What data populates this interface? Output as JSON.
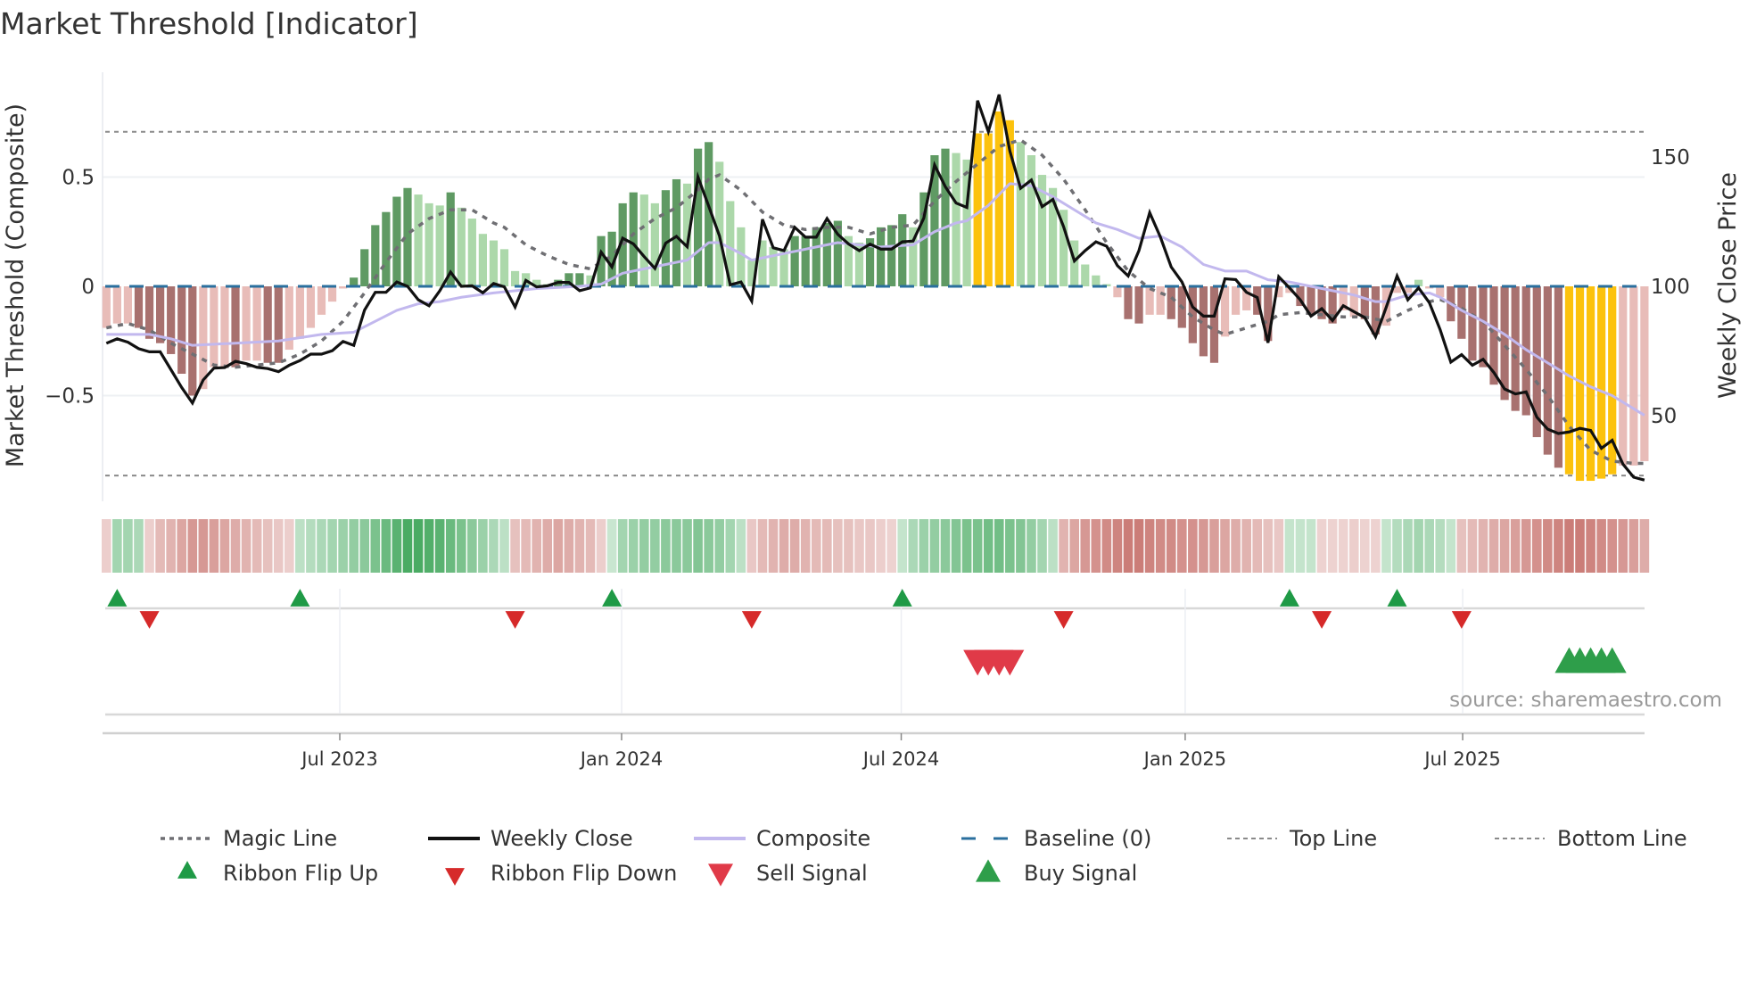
{
  "title": "Market Threshold [Indicator]",
  "source": "source: sharemaestro.com",
  "colors": {
    "dark_green": "#5f9a63",
    "light_green": "#acd8aa",
    "dark_red": "#a8716f",
    "light_red": "#e8bcb8",
    "gold": "#fcc20d",
    "close": "#111111",
    "composite": "#c2b8ee",
    "magic": "#6f6f73",
    "baseline": "#2a6f9e",
    "threshold": "#8a8a8a",
    "flip_up": "#1f9a46",
    "flip_down": "#d62a2a",
    "sell": "#e03a48",
    "buy": "#2e9e4a",
    "ribbon_green": "#3fa65a",
    "ribbon_red": "#c0605a"
  },
  "chart_data": {
    "type": "bar",
    "title": "Market Threshold [Indicator]",
    "xlabel": "",
    "ylabel": "Market Threshold (Composite)",
    "y2label": "Weekly Close Price",
    "ylim": [
      -0.98,
      0.98
    ],
    "y2lim": [
      17,
      183
    ],
    "yticks": [
      {
        "v": 0.5,
        "label": "0.5"
      },
      {
        "v": 0,
        "label": "0"
      },
      {
        "v": -0.5,
        "label": "−0.5"
      }
    ],
    "y2ticks": [
      {
        "v": 150,
        "label": "150"
      },
      {
        "v": 100,
        "label": "100"
      },
      {
        "v": 50,
        "label": "50"
      }
    ],
    "xticks": [
      {
        "week": 21.7,
        "label": "Jul 2023"
      },
      {
        "week": 47.9,
        "label": "Jan 2024"
      },
      {
        "week": 73.9,
        "label": "Jul 2024"
      },
      {
        "week": 100.3,
        "label": "Jan 2025"
      },
      {
        "week": 126.1,
        "label": "Jul 2025"
      }
    ],
    "weeks": 144,
    "top_line": 0.707,
    "bottom_line": -0.866,
    "baseline": 0,
    "composite_bars": [
      -0.19,
      -0.17,
      -0.17,
      -0.19,
      -0.24,
      -0.26,
      -0.31,
      -0.4,
      -0.5,
      -0.47,
      -0.37,
      -0.37,
      -0.37,
      -0.34,
      -0.34,
      -0.35,
      -0.35,
      -0.29,
      -0.24,
      -0.19,
      -0.13,
      -0.07,
      -0.01,
      0.04,
      0.17,
      0.28,
      0.34,
      0.41,
      0.45,
      0.42,
      0.38,
      0.37,
      0.43,
      0.36,
      0.31,
      0.24,
      0.21,
      0.17,
      0.07,
      0.06,
      0.03,
      0.01,
      0.03,
      0.06,
      0.06,
      0.05,
      0.23,
      0.25,
      0.38,
      0.43,
      0.42,
      0.38,
      0.44,
      0.49,
      0.47,
      0.63,
      0.66,
      0.57,
      0.39,
      0.27,
      0.12,
      0.21,
      0.18,
      0.17,
      0.23,
      0.23,
      0.27,
      0.29,
      0.3,
      0.23,
      0.2,
      0.22,
      0.27,
      0.28,
      0.33,
      0.27,
      0.43,
      0.6,
      0.63,
      0.61,
      0.58,
      0.7,
      0.7,
      0.8,
      0.76,
      0.66,
      0.6,
      0.51,
      0.45,
      0.35,
      0.21,
      0.1,
      0.05,
      0.01,
      -0.05,
      -0.15,
      -0.17,
      -0.13,
      -0.13,
      -0.15,
      -0.19,
      -0.26,
      -0.32,
      -0.35,
      -0.23,
      -0.13,
      -0.11,
      -0.13,
      -0.25,
      -0.05,
      -0.03,
      -0.09,
      -0.13,
      -0.15,
      -0.17,
      -0.11,
      -0.14,
      -0.15,
      -0.22,
      -0.18,
      -0.03,
      -0.03,
      0.03,
      -0.01,
      -0.05,
      -0.16,
      -0.24,
      -0.34,
      -0.37,
      -0.45,
      -0.52,
      -0.57,
      -0.59,
      -0.69,
      -0.77,
      -0.83,
      -0.86,
      -0.89,
      -0.89,
      -0.88,
      -0.86,
      -0.82,
      -0.82,
      -0.8
    ],
    "bar_states": [
      "LR",
      "LR",
      "LR",
      "DR",
      "DR",
      "DR",
      "DR",
      "DR",
      "DR",
      "LR",
      "LR",
      "LR",
      "DR",
      "LR",
      "LR",
      "DR",
      "DR",
      "LR",
      "LR",
      "LR",
      "LR",
      "LR",
      "LR",
      "DG",
      "DG",
      "DG",
      "DG",
      "DG",
      "DG",
      "LG",
      "LG",
      "LG",
      "DG",
      "LG",
      "LG",
      "LG",
      "LG",
      "LG",
      "LG",
      "LG",
      "LG",
      "LG",
      "DG",
      "DG",
      "DG",
      "LG",
      "DG",
      "DG",
      "DG",
      "DG",
      "LG",
      "LG",
      "DG",
      "DG",
      "LG",
      "DG",
      "DG",
      "LG",
      "LG",
      "LG",
      "LG",
      "LG",
      "LG",
      "LG",
      "DG",
      "DG",
      "DG",
      "DG",
      "DG",
      "LG",
      "LG",
      "DG",
      "DG",
      "DG",
      "DG",
      "LG",
      "DG",
      "DG",
      "DG",
      "LG",
      "LG",
      "GOLD",
      "GOLD",
      "GOLD",
      "GOLD",
      "LG",
      "LG",
      "LG",
      "LG",
      "LG",
      "LG",
      "LG",
      "LG",
      "LG",
      "LR",
      "DR",
      "DR",
      "LR",
      "LR",
      "DR",
      "DR",
      "DR",
      "DR",
      "DR",
      "LR",
      "LR",
      "LR",
      "DR",
      "DR",
      "LR",
      "LR",
      "DR",
      "DR",
      "DR",
      "DR",
      "LR",
      "LR",
      "DR",
      "DR",
      "LR",
      "LR",
      "LR",
      "LG",
      "LR",
      "LR",
      "DR",
      "DR",
      "DR",
      "DR",
      "DR",
      "DR",
      "DR",
      "DR",
      "DR",
      "DR",
      "DR",
      "GOLD",
      "GOLD",
      "GOLD",
      "GOLD",
      "GOLD",
      "LR",
      "LR",
      "LR"
    ],
    "weekly_close": [
      78,
      79.7,
      78.4,
      75.9,
      74.7,
      74.7,
      67.8,
      60.9,
      54.9,
      63.8,
      68.4,
      68.6,
      71,
      70.1,
      68.7,
      68.2,
      67,
      69.5,
      71.3,
      73.8,
      73.8,
      75.1,
      78.7,
      77.2,
      90.8,
      97.7,
      97.7,
      101.7,
      100,
      94.8,
      92.5,
      98.3,
      105.5,
      100,
      100.2,
      97.5,
      101.1,
      99.8,
      92,
      102.3,
      99.8,
      100.2,
      101.5,
      101.5,
      98.3,
      99.4,
      113.2,
      107.5,
      118.6,
      116.4,
      111.5,
      106.9,
      116.7,
      119.3,
      115.3,
      142.3,
      131,
      119.5,
      100.6,
      101.7,
      94.3,
      125.9,
      114.9,
      113.8,
      122.8,
      119,
      119,
      126.2,
      120.1,
      116.4,
      113.8,
      116.3,
      114.4,
      114.4,
      117.2,
      117.5,
      126.4,
      146.9,
      138.5,
      132.2,
      130.5,
      171.8,
      159.8,
      174.1,
      152.3,
      137.9,
      141.1,
      130.8,
      133.6,
      123,
      109.8,
      113.8,
      117.2,
      115.5,
      108,
      104,
      113.8,
      128.5,
      119,
      107.5,
      101.7,
      92,
      88.5,
      88.5,
      102.9,
      102.6,
      97.7,
      95.7,
      78.2,
      103.7,
      99.4,
      94.8,
      88.5,
      91.4,
      86.8,
      92.5,
      90.2,
      87.9,
      80.5,
      92,
      104,
      94.8,
      99.4,
      93.7,
      83.3,
      70.7,
      73.6,
      69.5,
      71.8,
      66.7,
      60.3,
      58.4,
      59.2,
      49.4,
      44.8,
      43.1,
      43.7,
      45.1,
      44.3,
      37.4,
      40.5,
      31.3,
      26.2,
      25.1
    ],
    "magic_line": [
      [
        0,
        -0.19
      ],
      [
        2,
        -0.17
      ],
      [
        4,
        -0.2
      ],
      [
        6,
        -0.26
      ],
      [
        8,
        -0.31
      ],
      [
        10,
        -0.36
      ],
      [
        12,
        -0.37
      ],
      [
        14,
        -0.36
      ],
      [
        16,
        -0.35
      ],
      [
        18,
        -0.31
      ],
      [
        20,
        -0.25
      ],
      [
        22,
        -0.16
      ],
      [
        24,
        -0.03
      ],
      [
        25,
        0.04
      ],
      [
        26,
        0.11
      ],
      [
        28,
        0.24
      ],
      [
        30,
        0.31
      ],
      [
        32,
        0.35
      ],
      [
        34,
        0.35
      ],
      [
        36,
        0.29
      ],
      [
        37,
        0.27
      ],
      [
        39,
        0.19
      ],
      [
        41,
        0.14
      ],
      [
        43,
        0.1
      ],
      [
        45,
        0.08
      ],
      [
        47,
        0.14
      ],
      [
        49,
        0.24
      ],
      [
        51,
        0.31
      ],
      [
        53,
        0.36
      ],
      [
        55,
        0.44
      ],
      [
        56,
        0.49
      ],
      [
        57,
        0.51
      ],
      [
        59,
        0.44
      ],
      [
        61,
        0.34
      ],
      [
        63,
        0.28
      ],
      [
        65,
        0.26
      ],
      [
        67,
        0.27
      ],
      [
        69,
        0.27
      ],
      [
        71,
        0.24
      ],
      [
        73,
        0.27
      ],
      [
        75,
        0.28
      ],
      [
        77,
        0.39
      ],
      [
        79,
        0.48
      ],
      [
        81,
        0.56
      ],
      [
        83,
        0.64
      ],
      [
        85,
        0.67
      ],
      [
        87,
        0.6
      ],
      [
        89,
        0.49
      ],
      [
        91,
        0.35
      ],
      [
        93,
        0.2
      ],
      [
        95,
        0.07
      ],
      [
        97,
        -0.01
      ],
      [
        99,
        -0.05
      ],
      [
        101,
        -0.14
      ],
      [
        103,
        -0.2
      ],
      [
        104,
        -0.22
      ],
      [
        106,
        -0.19
      ],
      [
        108,
        -0.16
      ],
      [
        109,
        -0.13
      ],
      [
        111,
        -0.12
      ],
      [
        113,
        -0.13
      ],
      [
        115,
        -0.14
      ],
      [
        117,
        -0.14
      ],
      [
        119,
        -0.16
      ],
      [
        121,
        -0.11
      ],
      [
        123,
        -0.07
      ],
      [
        124,
        -0.06
      ],
      [
        126,
        -0.1
      ],
      [
        128,
        -0.16
      ],
      [
        130,
        -0.27
      ],
      [
        132,
        -0.38
      ],
      [
        134,
        -0.5
      ],
      [
        136,
        -0.64
      ],
      [
        138,
        -0.75
      ],
      [
        140,
        -0.8
      ],
      [
        142,
        -0.81
      ],
      [
        143,
        -0.81
      ]
    ],
    "composite_line": [
      [
        0,
        -0.22
      ],
      [
        4,
        -0.22
      ],
      [
        6,
        -0.24
      ],
      [
        8,
        -0.27
      ],
      [
        12,
        -0.26
      ],
      [
        16,
        -0.25
      ],
      [
        20,
        -0.22
      ],
      [
        23,
        -0.21
      ],
      [
        25,
        -0.16
      ],
      [
        27,
        -0.11
      ],
      [
        29,
        -0.08
      ],
      [
        31,
        -0.07
      ],
      [
        33,
        -0.05
      ],
      [
        36,
        -0.03
      ],
      [
        40,
        -0.01
      ],
      [
        44,
        0.0
      ],
      [
        46,
        0.01
      ],
      [
        48,
        0.06
      ],
      [
        50,
        0.08
      ],
      [
        52,
        0.1
      ],
      [
        54,
        0.12
      ],
      [
        56,
        0.2
      ],
      [
        57,
        0.2
      ],
      [
        59,
        0.15
      ],
      [
        60,
        0.12
      ],
      [
        62,
        0.14
      ],
      [
        64,
        0.16
      ],
      [
        66,
        0.18
      ],
      [
        68,
        0.2
      ],
      [
        70,
        0.19
      ],
      [
        72,
        0.18
      ],
      [
        75,
        0.19
      ],
      [
        77,
        0.25
      ],
      [
        79,
        0.29
      ],
      [
        80,
        0.3
      ],
      [
        82,
        0.37
      ],
      [
        84,
        0.47
      ],
      [
        86,
        0.46
      ],
      [
        88,
        0.41
      ],
      [
        90,
        0.35
      ],
      [
        92,
        0.29
      ],
      [
        94,
        0.26
      ],
      [
        96,
        0.22
      ],
      [
        98,
        0.23
      ],
      [
        100,
        0.18
      ],
      [
        102,
        0.1
      ],
      [
        104,
        0.07
      ],
      [
        106,
        0.07
      ],
      [
        108,
        0.03
      ],
      [
        110,
        0.02
      ],
      [
        112,
        0.0
      ],
      [
        114,
        -0.02
      ],
      [
        116,
        -0.04
      ],
      [
        118,
        -0.07
      ],
      [
        119,
        -0.07
      ],
      [
        121,
        -0.04
      ],
      [
        123,
        -0.03
      ],
      [
        124,
        -0.05
      ],
      [
        126,
        -0.11
      ],
      [
        128,
        -0.16
      ],
      [
        130,
        -0.22
      ],
      [
        132,
        -0.29
      ],
      [
        134,
        -0.35
      ],
      [
        136,
        -0.41
      ],
      [
        138,
        -0.46
      ],
      [
        140,
        -0.5
      ],
      [
        142,
        -0.56
      ],
      [
        143,
        -0.59
      ]
    ],
    "ribbon": [
      -0.15,
      0.35,
      0.35,
      0.3,
      -0.15,
      -0.3,
      -0.35,
      -0.45,
      -0.55,
      -0.55,
      -0.5,
      -0.45,
      -0.4,
      -0.35,
      -0.3,
      -0.25,
      -0.2,
      -0.15,
      0.2,
      0.25,
      0.3,
      0.35,
      0.4,
      0.45,
      0.5,
      0.6,
      0.7,
      0.8,
      0.9,
      0.9,
      0.85,
      0.8,
      0.7,
      0.6,
      0.5,
      0.4,
      0.3,
      0.2,
      -0.25,
      -0.3,
      -0.35,
      -0.4,
      -0.45,
      -0.4,
      -0.35,
      -0.3,
      -0.15,
      0.12,
      0.35,
      0.4,
      0.45,
      0.45,
      0.5,
      0.5,
      0.5,
      0.55,
      0.5,
      0.45,
      0.35,
      0.2,
      -0.2,
      -0.3,
      -0.35,
      -0.4,
      -0.4,
      -0.35,
      -0.3,
      -0.3,
      -0.25,
      -0.25,
      -0.2,
      -0.2,
      -0.15,
      -0.12,
      0.15,
      0.3,
      0.4,
      0.45,
      0.5,
      0.55,
      0.6,
      0.6,
      0.65,
      0.65,
      0.6,
      0.55,
      0.45,
      0.35,
      0.2,
      -0.35,
      -0.45,
      -0.55,
      -0.6,
      -0.65,
      -0.7,
      -0.75,
      -0.75,
      -0.7,
      -0.65,
      -0.65,
      -0.6,
      -0.6,
      -0.55,
      -0.5,
      -0.45,
      -0.4,
      -0.35,
      -0.3,
      -0.25,
      -0.2,
      0.15,
      0.15,
      0.15,
      -0.12,
      -0.12,
      -0.12,
      -0.15,
      -0.12,
      -0.12,
      0.15,
      0.25,
      0.3,
      0.35,
      0.3,
      0.25,
      0.15,
      -0.25,
      -0.3,
      -0.35,
      -0.4,
      -0.45,
      -0.5,
      -0.55,
      -0.6,
      -0.65,
      -0.7,
      -0.75,
      -0.75,
      -0.7,
      -0.65,
      -0.6,
      -0.55,
      -0.5,
      -0.4
    ],
    "ribbon_flip_up": [
      1,
      18,
      47,
      74,
      110,
      120
    ],
    "ribbon_flip_down": [
      4,
      38,
      60,
      89,
      113,
      126
    ],
    "sell_signal": [
      81,
      82,
      83,
      84
    ],
    "buy_signal": [
      136,
      137,
      138,
      139,
      140
    ],
    "legend": {
      "placement": "bottom",
      "items": [
        {
          "label": "Magic Line",
          "kind": "dotted"
        },
        {
          "label": "Weekly Close",
          "kind": "solid"
        },
        {
          "label": "Composite",
          "kind": "composite"
        },
        {
          "label": "Baseline (0)",
          "kind": "dashed"
        },
        {
          "label": "Top Line",
          "kind": "thin-dotted"
        },
        {
          "label": "Bottom Line",
          "kind": "thin-dotted"
        },
        {
          "label": "Ribbon Flip Up",
          "kind": "up"
        },
        {
          "label": "Ribbon Flip Down",
          "kind": "down"
        },
        {
          "label": "Sell Signal",
          "kind": "sell"
        },
        {
          "label": "Buy Signal",
          "kind": "buy"
        }
      ]
    }
  }
}
